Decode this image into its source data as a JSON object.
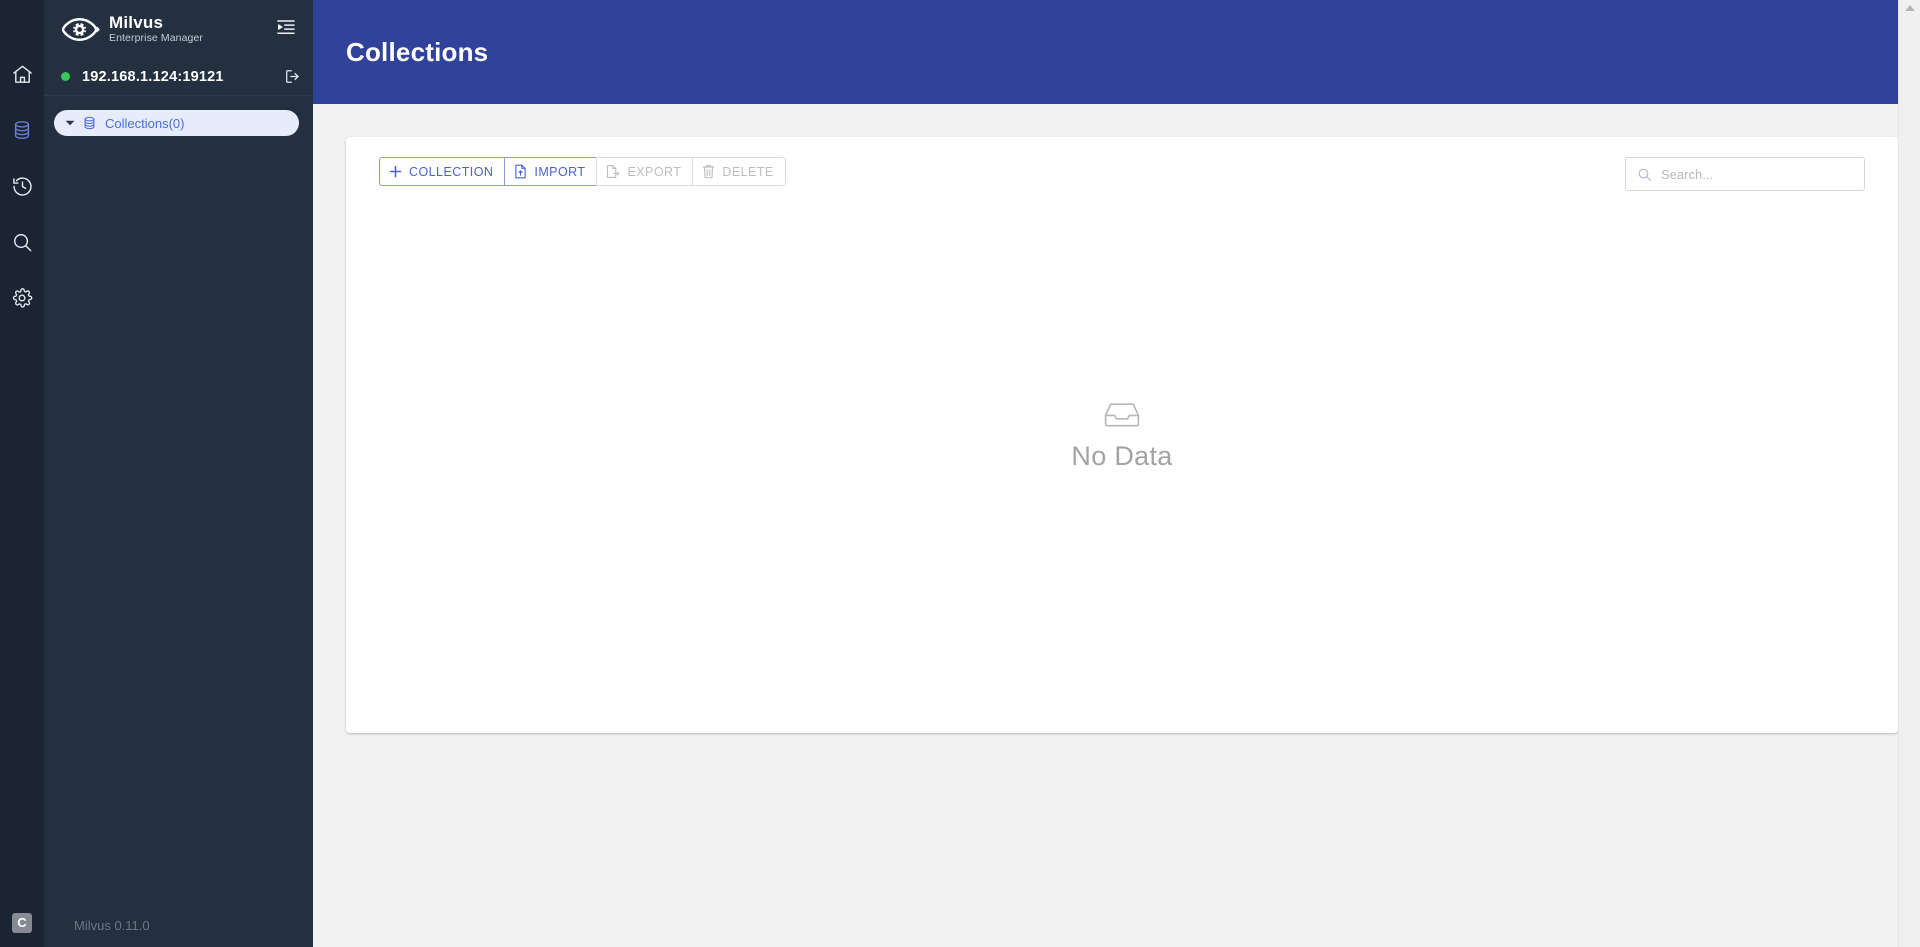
{
  "brand": {
    "name": "Milvus",
    "subtitle": "Enterprise Manager",
    "logo_icon": "milvus-eye-logo",
    "collapse_icon": "collapse-menu-icon"
  },
  "connection": {
    "address": "192.168.1.124:19121",
    "status": "connected",
    "status_color": "#35c759",
    "disconnect_icon": "logout-icon"
  },
  "rail": {
    "items": [
      {
        "name": "home",
        "icon": "home-icon",
        "active": false
      },
      {
        "name": "database",
        "icon": "database-icon",
        "active": true
      },
      {
        "name": "history",
        "icon": "history-icon",
        "active": false
      },
      {
        "name": "search",
        "icon": "search-icon",
        "active": false
      },
      {
        "name": "settings",
        "icon": "gear-icon",
        "active": false
      }
    ],
    "bottom_badge": "C"
  },
  "tree": {
    "items": [
      {
        "label": "Collections(0)",
        "icon": "database-icon",
        "caret": "chevron-down-icon",
        "selected": true
      }
    ]
  },
  "footer": {
    "version": "Milvus 0.11.0"
  },
  "header": {
    "title": "Collections",
    "background": "#304299"
  },
  "toolbar": {
    "buttons": [
      {
        "label": "COLLECTION",
        "icon": "plus-icon",
        "disabled": false
      },
      {
        "label": "IMPORT",
        "icon": "file-import-icon",
        "disabled": false
      },
      {
        "label": "EXPORT",
        "icon": "file-export-icon",
        "disabled": true
      },
      {
        "label": "DELETE",
        "icon": "trash-icon",
        "disabled": true
      }
    ]
  },
  "search": {
    "value": "",
    "placeholder": "Search...",
    "icon": "search-icon"
  },
  "empty_state": {
    "text": "No Data",
    "icon": "inbox-icon"
  },
  "scrollbar": {
    "up_arrow": "scroll-up-arrow"
  },
  "colors": {
    "accent": "#4a62cf",
    "header_blue": "#304299",
    "rail_dark": "#1b2433",
    "panel_dark": "#242f40",
    "selected_pill": "#e7ecfb",
    "page_bg": "#f2f2f2"
  }
}
